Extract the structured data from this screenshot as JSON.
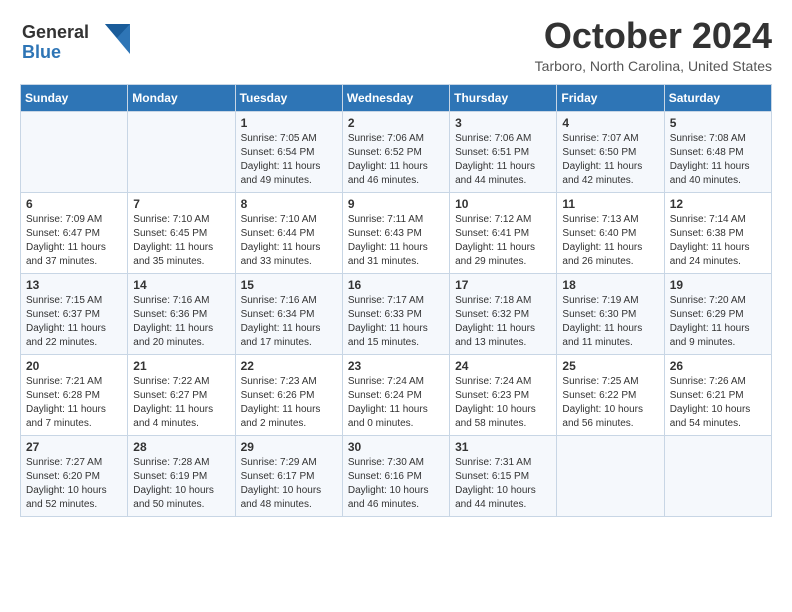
{
  "header": {
    "logo_line1": "General",
    "logo_line2": "Blue",
    "month_title": "October 2024",
    "location": "Tarboro, North Carolina, United States"
  },
  "columns": [
    "Sunday",
    "Monday",
    "Tuesday",
    "Wednesday",
    "Thursday",
    "Friday",
    "Saturday"
  ],
  "weeks": [
    [
      {
        "day": "",
        "info": ""
      },
      {
        "day": "",
        "info": ""
      },
      {
        "day": "1",
        "info": "Sunrise: 7:05 AM\nSunset: 6:54 PM\nDaylight: 11 hours and 49 minutes."
      },
      {
        "day": "2",
        "info": "Sunrise: 7:06 AM\nSunset: 6:52 PM\nDaylight: 11 hours and 46 minutes."
      },
      {
        "day": "3",
        "info": "Sunrise: 7:06 AM\nSunset: 6:51 PM\nDaylight: 11 hours and 44 minutes."
      },
      {
        "day": "4",
        "info": "Sunrise: 7:07 AM\nSunset: 6:50 PM\nDaylight: 11 hours and 42 minutes."
      },
      {
        "day": "5",
        "info": "Sunrise: 7:08 AM\nSunset: 6:48 PM\nDaylight: 11 hours and 40 minutes."
      }
    ],
    [
      {
        "day": "6",
        "info": "Sunrise: 7:09 AM\nSunset: 6:47 PM\nDaylight: 11 hours and 37 minutes."
      },
      {
        "day": "7",
        "info": "Sunrise: 7:10 AM\nSunset: 6:45 PM\nDaylight: 11 hours and 35 minutes."
      },
      {
        "day": "8",
        "info": "Sunrise: 7:10 AM\nSunset: 6:44 PM\nDaylight: 11 hours and 33 minutes."
      },
      {
        "day": "9",
        "info": "Sunrise: 7:11 AM\nSunset: 6:43 PM\nDaylight: 11 hours and 31 minutes."
      },
      {
        "day": "10",
        "info": "Sunrise: 7:12 AM\nSunset: 6:41 PM\nDaylight: 11 hours and 29 minutes."
      },
      {
        "day": "11",
        "info": "Sunrise: 7:13 AM\nSunset: 6:40 PM\nDaylight: 11 hours and 26 minutes."
      },
      {
        "day": "12",
        "info": "Sunrise: 7:14 AM\nSunset: 6:38 PM\nDaylight: 11 hours and 24 minutes."
      }
    ],
    [
      {
        "day": "13",
        "info": "Sunrise: 7:15 AM\nSunset: 6:37 PM\nDaylight: 11 hours and 22 minutes."
      },
      {
        "day": "14",
        "info": "Sunrise: 7:16 AM\nSunset: 6:36 PM\nDaylight: 11 hours and 20 minutes."
      },
      {
        "day": "15",
        "info": "Sunrise: 7:16 AM\nSunset: 6:34 PM\nDaylight: 11 hours and 17 minutes."
      },
      {
        "day": "16",
        "info": "Sunrise: 7:17 AM\nSunset: 6:33 PM\nDaylight: 11 hours and 15 minutes."
      },
      {
        "day": "17",
        "info": "Sunrise: 7:18 AM\nSunset: 6:32 PM\nDaylight: 11 hours and 13 minutes."
      },
      {
        "day": "18",
        "info": "Sunrise: 7:19 AM\nSunset: 6:30 PM\nDaylight: 11 hours and 11 minutes."
      },
      {
        "day": "19",
        "info": "Sunrise: 7:20 AM\nSunset: 6:29 PM\nDaylight: 11 hours and 9 minutes."
      }
    ],
    [
      {
        "day": "20",
        "info": "Sunrise: 7:21 AM\nSunset: 6:28 PM\nDaylight: 11 hours and 7 minutes."
      },
      {
        "day": "21",
        "info": "Sunrise: 7:22 AM\nSunset: 6:27 PM\nDaylight: 11 hours and 4 minutes."
      },
      {
        "day": "22",
        "info": "Sunrise: 7:23 AM\nSunset: 6:26 PM\nDaylight: 11 hours and 2 minutes."
      },
      {
        "day": "23",
        "info": "Sunrise: 7:24 AM\nSunset: 6:24 PM\nDaylight: 11 hours and 0 minutes."
      },
      {
        "day": "24",
        "info": "Sunrise: 7:24 AM\nSunset: 6:23 PM\nDaylight: 10 hours and 58 minutes."
      },
      {
        "day": "25",
        "info": "Sunrise: 7:25 AM\nSunset: 6:22 PM\nDaylight: 10 hours and 56 minutes."
      },
      {
        "day": "26",
        "info": "Sunrise: 7:26 AM\nSunset: 6:21 PM\nDaylight: 10 hours and 54 minutes."
      }
    ],
    [
      {
        "day": "27",
        "info": "Sunrise: 7:27 AM\nSunset: 6:20 PM\nDaylight: 10 hours and 52 minutes."
      },
      {
        "day": "28",
        "info": "Sunrise: 7:28 AM\nSunset: 6:19 PM\nDaylight: 10 hours and 50 minutes."
      },
      {
        "day": "29",
        "info": "Sunrise: 7:29 AM\nSunset: 6:17 PM\nDaylight: 10 hours and 48 minutes."
      },
      {
        "day": "30",
        "info": "Sunrise: 7:30 AM\nSunset: 6:16 PM\nDaylight: 10 hours and 46 minutes."
      },
      {
        "day": "31",
        "info": "Sunrise: 7:31 AM\nSunset: 6:15 PM\nDaylight: 10 hours and 44 minutes."
      },
      {
        "day": "",
        "info": ""
      },
      {
        "day": "",
        "info": ""
      }
    ]
  ]
}
